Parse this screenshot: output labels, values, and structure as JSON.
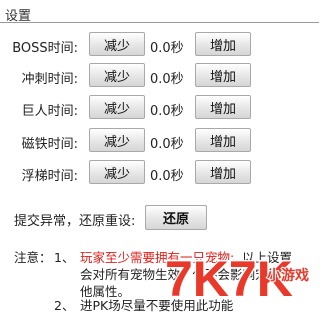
{
  "header": {
    "title": "设置"
  },
  "timers": [
    {
      "label": "BOSS时间:",
      "dec_label": "减少",
      "value": "0.0秒",
      "inc_label": "增加"
    },
    {
      "label": "冲刺时间:",
      "dec_label": "减少",
      "value": "0.0秒",
      "inc_label": "增加"
    },
    {
      "label": "巨人时间:",
      "dec_label": "减少",
      "value": "0.0秒",
      "inc_label": "增加"
    },
    {
      "label": "磁铁时间:",
      "dec_label": "减少",
      "value": "0.0秒",
      "inc_label": "增加"
    },
    {
      "label": "浮梯时间:",
      "dec_label": "减少",
      "value": "0.0秒",
      "inc_label": "增加"
    }
  ],
  "reset": {
    "label": "提交异常，还原重设:",
    "button_label": "还原"
  },
  "notes": {
    "prefix": "注意：",
    "item1_num": "1、",
    "item1_red": "玩家至少需要拥有一只宠物;",
    "item1_rest": "以上设置",
    "item1_line2": "会对所有宠物生效，但不会影响宠物其",
    "item1_line3": "他属性。",
    "item2_num": "2、",
    "item2_text": "进PK场尽量不要使用此功能"
  },
  "watermark": {
    "brand": "7K7K",
    "sub": "小游戏",
    "colors": {
      "primary": "#e8392b",
      "outline": "#ffffff"
    }
  }
}
